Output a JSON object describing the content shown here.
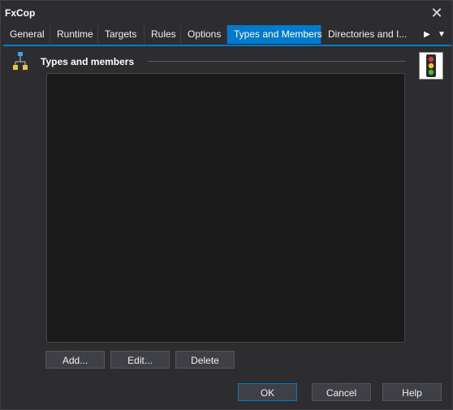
{
  "window": {
    "title": "FxCop"
  },
  "tabs": [
    {
      "label": "General"
    },
    {
      "label": "Runtime"
    },
    {
      "label": "Targets"
    },
    {
      "label": "Rules"
    },
    {
      "label": "Options"
    },
    {
      "label": "Types and Members",
      "active": true
    },
    {
      "label": "Directories and I..."
    }
  ],
  "tab_controls": {
    "next_glyph": "▶",
    "menu_glyph": "▼"
  },
  "section": {
    "title": "Types and members",
    "icon": "hierarchy-icon",
    "badge_icon": "traffic-light-icon"
  },
  "listbox": {
    "items": []
  },
  "list_buttons": {
    "add": "Add...",
    "edit": "Edit...",
    "delete": "Delete"
  },
  "footer_buttons": {
    "ok": "OK",
    "cancel": "Cancel",
    "help": "Help"
  },
  "colors": {
    "accent": "#007acc",
    "background": "#2d2d30",
    "list_background": "#1b1b1c"
  }
}
